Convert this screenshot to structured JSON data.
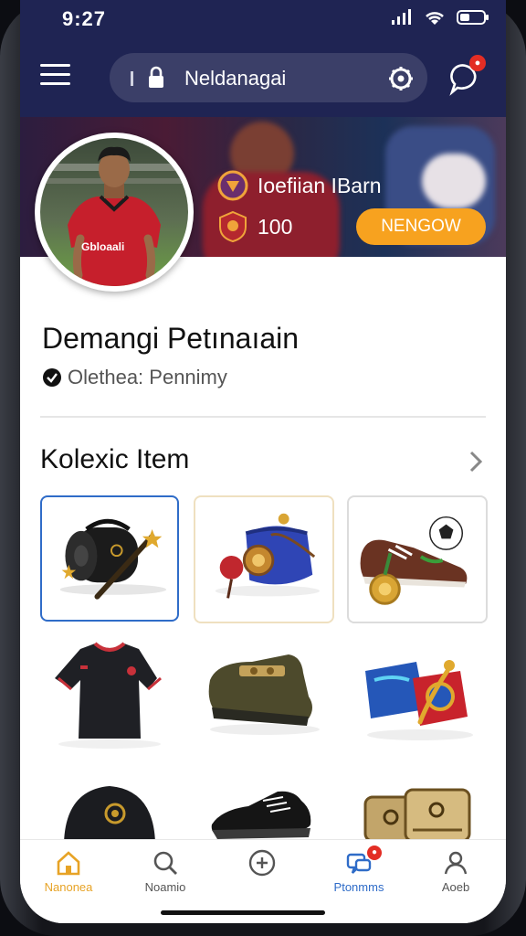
{
  "status": {
    "time": "9:27"
  },
  "search": {
    "text": "Neldanagai"
  },
  "profile": {
    "team_name": "Ioefiian IBarn",
    "points": "100",
    "follow_label": "NENGOW",
    "jersey_text": "Gbloaali",
    "name": "Demangi Petınaıain",
    "subtitle": "Olethea: Pennimy"
  },
  "collection": {
    "title": "Kolexic Item",
    "items": [
      {
        "icon": "black-bag-with-wand-icon",
        "selected": true
      },
      {
        "icon": "blue-pouch-with-key-icon",
        "selected": false
      },
      {
        "icon": "football-boot-with-medal-icon",
        "selected": false
      },
      {
        "icon": "black-jersey-icon",
        "selected": false
      },
      {
        "icon": "green-shoe-icon",
        "selected": false
      },
      {
        "icon": "blue-red-bags-icon",
        "selected": false
      },
      {
        "icon": "black-cap-icon",
        "selected": false
      },
      {
        "icon": "black-shoe-icon",
        "selected": false
      },
      {
        "icon": "tan-wallets-icon",
        "selected": false
      }
    ]
  },
  "nav": {
    "items": [
      {
        "label": "Nanonea",
        "icon": "home-icon",
        "active": true
      },
      {
        "label": "Noamio",
        "icon": "search-icon",
        "active": false
      },
      {
        "label": "",
        "icon": "add-circle-icon",
        "active": false
      },
      {
        "label": "Ptonmms",
        "icon": "messages-icon",
        "active": false,
        "badge": ""
      },
      {
        "label": "Aoeb",
        "icon": "profile-icon",
        "active": false
      }
    ]
  },
  "colors": {
    "header": "#1f2453",
    "accent": "#f7a21f",
    "active": "#e7a326",
    "badge": "#e32d24",
    "link": "#2f6cc8"
  }
}
